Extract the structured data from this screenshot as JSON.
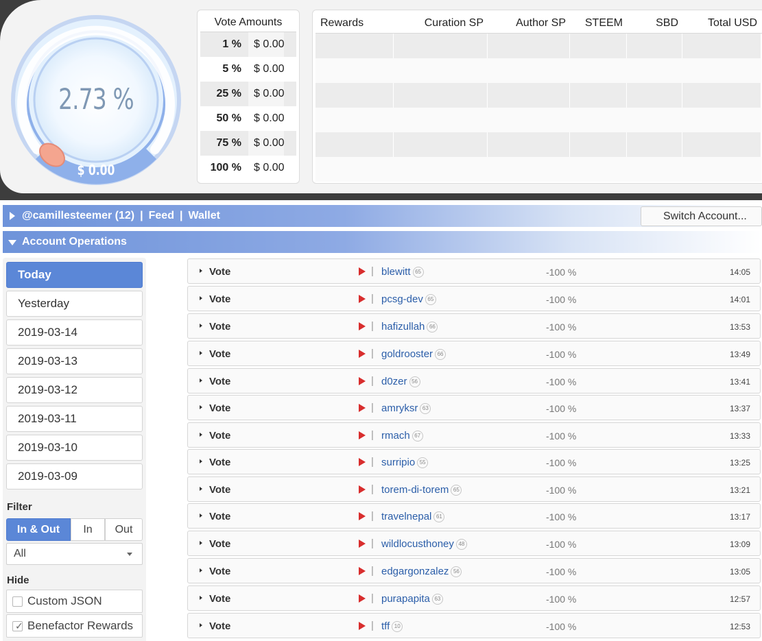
{
  "gauge": {
    "percent": "2.73 %",
    "usd": "$ 0.00"
  },
  "vote_amounts": {
    "title": "Vote Amounts",
    "rows": [
      {
        "pct": "1 %",
        "usd": "$ 0.00"
      },
      {
        "pct": "5 %",
        "usd": "$ 0.00"
      },
      {
        "pct": "25 %",
        "usd": "$ 0.00"
      },
      {
        "pct": "50 %",
        "usd": "$ 0.00"
      },
      {
        "pct": "75 %",
        "usd": "$ 0.00"
      },
      {
        "pct": "100 %",
        "usd": "$ 0.00"
      }
    ]
  },
  "rewards": {
    "headers": [
      "Rewards",
      "Curation SP",
      "Author SP",
      "STEEM",
      "SBD",
      "Total USD"
    ]
  },
  "account_bar": {
    "account": "@camillesteemer (12)",
    "feed": "Feed",
    "wallet": "Wallet",
    "separator": "|",
    "switch_label": "Switch Account..."
  },
  "ops_bar": {
    "title": "Account Operations"
  },
  "days": [
    "Today",
    "Yesterday",
    "2019-03-14",
    "2019-03-13",
    "2019-03-12",
    "2019-03-11",
    "2019-03-10",
    "2019-03-09"
  ],
  "filter": {
    "label": "Filter",
    "options": [
      "In & Out",
      "In",
      "Out"
    ],
    "select_value": "All"
  },
  "hide": {
    "label": "Hide",
    "items": [
      {
        "label": "Custom JSON",
        "checked": false
      },
      {
        "label": "Benefactor Rewards",
        "checked": true
      }
    ]
  },
  "operations": [
    {
      "type": "Vote",
      "user": "blewitt",
      "rep": "65",
      "pct": "-100 %",
      "time": "14:05"
    },
    {
      "type": "Vote",
      "user": "pcsg-dev",
      "rep": "65",
      "pct": "-100 %",
      "time": "14:01"
    },
    {
      "type": "Vote",
      "user": "hafizullah",
      "rep": "66",
      "pct": "-100 %",
      "time": "13:53"
    },
    {
      "type": "Vote",
      "user": "goldrooster",
      "rep": "66",
      "pct": "-100 %",
      "time": "13:49"
    },
    {
      "type": "Vote",
      "user": "d0zer",
      "rep": "56",
      "pct": "-100 %",
      "time": "13:41"
    },
    {
      "type": "Vote",
      "user": "amryksr",
      "rep": "63",
      "pct": "-100 %",
      "time": "13:37"
    },
    {
      "type": "Vote",
      "user": "rmach",
      "rep": "67",
      "pct": "-100 %",
      "time": "13:33"
    },
    {
      "type": "Vote",
      "user": "surripio",
      "rep": "55",
      "pct": "-100 %",
      "time": "13:25"
    },
    {
      "type": "Vote",
      "user": "torem-di-torem",
      "rep": "65",
      "pct": "-100 %",
      "time": "13:21"
    },
    {
      "type": "Vote",
      "user": "travelnepal",
      "rep": "61",
      "pct": "-100 %",
      "time": "13:17"
    },
    {
      "type": "Vote",
      "user": "wildlocusthoney",
      "rep": "48",
      "pct": "-100 %",
      "time": "13:09"
    },
    {
      "type": "Vote",
      "user": "edgargonzalez",
      "rep": "56",
      "pct": "-100 %",
      "time": "13:05"
    },
    {
      "type": "Vote",
      "user": "purapapita",
      "rep": "63",
      "pct": "-100 %",
      "time": "12:57"
    },
    {
      "type": "Vote",
      "user": "tff",
      "rep": "10",
      "pct": "-100 %",
      "time": "12:53"
    }
  ],
  "colors": {
    "accent": "#5b87d7",
    "link": "#2b5ea9",
    "play": "#d82d2d",
    "gauge_knob": "#f4a58f"
  },
  "icons": [
    "expand-right-icon",
    "collapse-down-icon",
    "play-icon",
    "dropdown-caret-icon",
    "checkbox-icon",
    "checkmark-icon"
  ]
}
